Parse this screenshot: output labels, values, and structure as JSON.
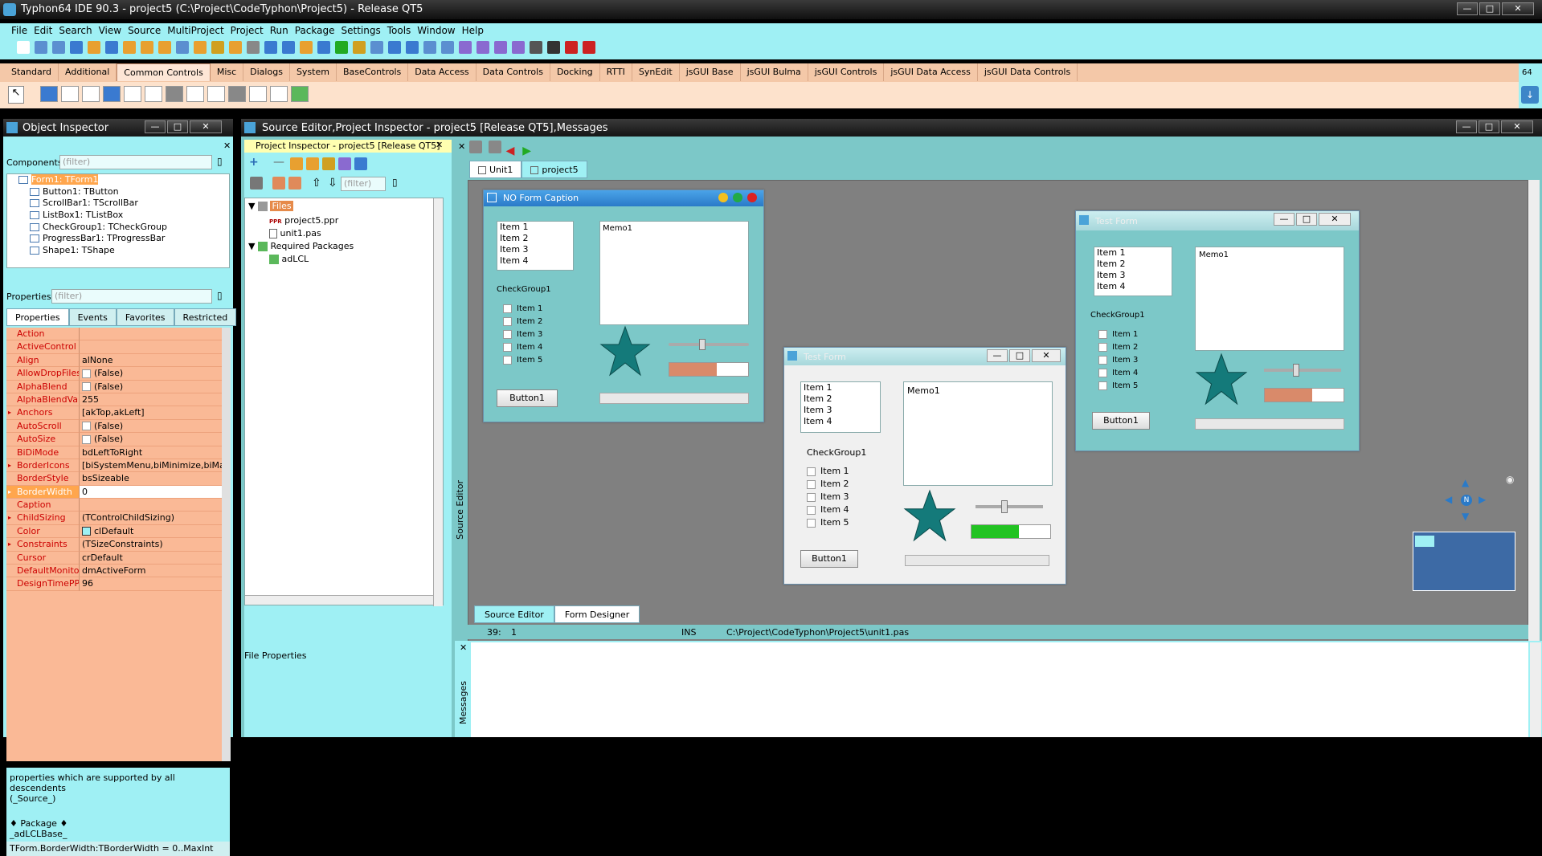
{
  "window": {
    "title": "Typhon64 IDE 90.3 - project5 (C:\\Project\\CodeTyphon\\Project5) - Release QT5"
  },
  "menu": [
    "File",
    "Edit",
    "Search",
    "View",
    "Source",
    "MultiProject",
    "Project",
    "Run",
    "Package",
    "Settings",
    "Tools",
    "Window",
    "Help"
  ],
  "palette": {
    "tabs": [
      "Standard",
      "Additional",
      "Common Controls",
      "Misc",
      "Dialogs",
      "System",
      "BaseControls",
      "Data Access",
      "Data Controls",
      "Docking",
      "RTTI",
      "SynEdit",
      "jsGUI Base",
      "jsGUI Bulma",
      "jsGUI Controls",
      "jsGUI Data Access",
      "jsGUI Data Controls"
    ],
    "selected": "Common Controls",
    "side_label": "64"
  },
  "object_inspector": {
    "title": "Object Inspector",
    "components_label": "Components",
    "filter_placeholder": "(filter)",
    "tree": [
      "Form1: TForm1",
      "Button1: TButton",
      "ScrollBar1: TScrollBar",
      "ListBox1: TListBox",
      "CheckGroup1: TCheckGroup",
      "ProgressBar1: TProgressBar",
      "Shape1: TShape"
    ],
    "properties_label": "Properties",
    "tabs": [
      "Properties",
      "Events",
      "Favorites",
      "Restricted"
    ],
    "props": [
      {
        "n": "Action",
        "v": ""
      },
      {
        "n": "ActiveControl",
        "v": ""
      },
      {
        "n": "Align",
        "v": "alNone"
      },
      {
        "n": "AllowDropFiles",
        "v": "(False)"
      },
      {
        "n": "AlphaBlend",
        "v": "(False)"
      },
      {
        "n": "AlphaBlendValue",
        "v": "255"
      },
      {
        "n": "Anchors",
        "v": "[akTop,akLeft]"
      },
      {
        "n": "AutoScroll",
        "v": "(False)"
      },
      {
        "n": "AutoSize",
        "v": "(False)"
      },
      {
        "n": "BiDiMode",
        "v": "bdLeftToRight"
      },
      {
        "n": "BorderIcons",
        "v": "[biSystemMenu,biMinimize,biMa:"
      },
      {
        "n": "BorderStyle",
        "v": "bsSizeable"
      },
      {
        "n": "BorderWidth",
        "v": "0"
      },
      {
        "n": "Caption",
        "v": ""
      },
      {
        "n": "ChildSizing",
        "v": "(TControlChildSizing)"
      },
      {
        "n": "Color",
        "v": "clDefault"
      },
      {
        "n": "Constraints",
        "v": "(TSizeConstraints)"
      },
      {
        "n": "Cursor",
        "v": "crDefault"
      },
      {
        "n": "DefaultMonitor",
        "v": "dmActiveForm"
      },
      {
        "n": "DesignTimePPI",
        "v": "96"
      }
    ],
    "hint1": "properties which are supported by all descendents",
    "hint2": "(_Source_)",
    "hint3": "♦ Package ♦",
    "hint4": "_adLCLBase_",
    "status": "TForm.BorderWidth:TBorderWidth = 0..MaxInt"
  },
  "source_editor": {
    "title": "Source Editor,Project Inspector - project5 [Release QT5],Messages",
    "side_label": "Source Editor",
    "messages_label": "Messages"
  },
  "project_inspector": {
    "title": "Project Inspector - project5 [Release QT5]",
    "filter_placeholder": "(filter)",
    "files_label": "Files",
    "file1": "project5.ppr",
    "file2": "unit1.pas",
    "req": "Required Packages",
    "pkg": "adLCL",
    "file_props": "File Properties"
  },
  "editor_tabs": [
    "Unit1",
    "project5"
  ],
  "bottom_tabs": [
    "Source Editor",
    "Form Designer"
  ],
  "status": {
    "pos": "39:",
    "col": "1",
    "mode": "INS",
    "path": "C:\\Project\\CodeTyphon\\Project5\\unit1.pas"
  },
  "design_form": {
    "title": "NO Form Caption",
    "items": [
      "Item 1",
      "Item 2",
      "Item 3",
      "Item 4"
    ],
    "memo": "Memo1",
    "checkgroup": "CheckGroup1",
    "checks": [
      "Item 1",
      "Item 2",
      "Item 3",
      "Item 4",
      "Item 5"
    ],
    "button": "Button1"
  },
  "test_form_a": {
    "title": "Test Form",
    "items": [
      "Item 1",
      "Item 2",
      "Item 3",
      "Item 4"
    ],
    "memo": "Memo1",
    "checkgroup": "CheckGroup1",
    "checks": [
      "Item 1",
      "Item 2",
      "Item 3",
      "Item 4",
      "Item 5"
    ],
    "button": "Button1",
    "progress": 0.6
  },
  "test_form_b": {
    "title": "Test Form",
    "items": [
      "Item 1",
      "Item 2",
      "Item 3",
      "Item 4"
    ],
    "memo": "Memo1",
    "checkgroup": "CheckGroup1",
    "checks": [
      "Item 1",
      "Item 2",
      "Item 3",
      "Item 4",
      "Item 5"
    ],
    "button": "Button1",
    "progress": 0.6
  },
  "colors": {
    "cyan": "#9ff0f4",
    "teal": "#7cc8c8",
    "orange": "#fab996",
    "designer_bg": "#808080",
    "progress_green": "#22c322",
    "progress_orange": "#d98a6a"
  }
}
